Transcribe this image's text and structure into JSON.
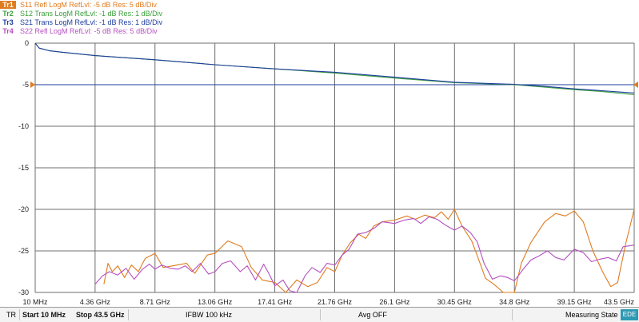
{
  "legend": [
    {
      "tag": "Tr1",
      "text": "S11 Refl LogM RefLvl: -5  dB Res: 5  dB/Div",
      "color": "#e07b1f",
      "active": true
    },
    {
      "tag": "Tr2",
      "text": "S12 Trans LogM RefLvl: -1  dB Res: 1  dB/Div",
      "color": "#3aa03a",
      "active": false
    },
    {
      "tag": "Tr3",
      "text": "S21 Trans LogM RefLvl: -1  dB Res: 1  dB/Div",
      "color": "#1f3f9e",
      "active": false
    },
    {
      "tag": "Tr4",
      "text": "S22 Refl LogM RefLvl: -5  dB Res: 5  dB/Div",
      "color": "#b44fc0",
      "active": false
    }
  ],
  "chart_data": {
    "type": "line",
    "x_tick_labels": [
      "10 MHz",
      "4.36 GHz",
      "8.71 GHz",
      "13.06 GHz",
      "17.41 GHz",
      "21.76 GHz",
      "26.1 GHz",
      "30.45 GHz",
      "34.8 GHz",
      "39.15 GHz",
      "43.5 GHz"
    ],
    "y_tick_labels": [
      "0",
      "-5",
      "-10",
      "-15",
      "-20",
      "-25",
      "-30"
    ],
    "xlim": [
      0.01,
      43.5
    ],
    "ylim": [
      -30,
      0
    ],
    "y_ticks": [
      0,
      -5,
      -10,
      -15,
      -20,
      -25,
      -30
    ],
    "grid": true,
    "ref_level": -5,
    "series": [
      {
        "name": "S12",
        "color": "#3aa03a",
        "x": [
          0.01,
          0.3,
          1.0,
          2.0,
          4.36,
          8.71,
          13.06,
          17.41,
          21.76,
          26.1,
          30.45,
          34.8,
          37.0,
          39.15,
          41.0,
          43.5
        ],
        "y": [
          0.0,
          -0.6,
          -0.9,
          -1.1,
          -1.5,
          -2.0,
          -2.6,
          -3.1,
          -3.6,
          -4.2,
          -4.75,
          -5.0,
          -5.3,
          -5.6,
          -5.8,
          -6.2
        ]
      },
      {
        "name": "S21",
        "color": "#1f3f9e",
        "x": [
          0.01,
          0.3,
          1.0,
          2.0,
          4.36,
          8.71,
          13.06,
          17.41,
          21.76,
          26.1,
          30.45,
          34.8,
          37.0,
          39.15,
          41.0,
          43.5
        ],
        "y": [
          0.0,
          -0.6,
          -0.9,
          -1.1,
          -1.5,
          -2.0,
          -2.6,
          -3.1,
          -3.5,
          -4.1,
          -4.7,
          -4.95,
          -5.2,
          -5.5,
          -5.7,
          -6.0
        ]
      },
      {
        "name": "S11",
        "color": "#e07b1f",
        "x": [
          5.0,
          5.3,
          5.6,
          6.0,
          6.5,
          7.0,
          7.5,
          8.0,
          8.71,
          9.3,
          10.0,
          11.0,
          11.6,
          12.5,
          13.06,
          14.0,
          15.0,
          15.7,
          16.5,
          17.41,
          18.2,
          19.0,
          19.8,
          20.5,
          21.2,
          21.76,
          22.3,
          22.9,
          23.5,
          24.0,
          24.6,
          25.2,
          26.1,
          27.0,
          27.6,
          28.3,
          29.0,
          29.5,
          30.0,
          30.45,
          31.0,
          31.7,
          32.2,
          32.7,
          33.3,
          34.0,
          34.8,
          35.3,
          36.0,
          37.0,
          37.8,
          38.5,
          39.15,
          39.8,
          40.5,
          41.2,
          41.8,
          42.3,
          42.9,
          43.5
        ],
        "y": [
          -29.0,
          -26.5,
          -27.5,
          -26.8,
          -28.2,
          -26.7,
          -27.5,
          -25.9,
          -25.3,
          -27.0,
          -26.8,
          -26.5,
          -27.7,
          -25.5,
          -25.3,
          -23.8,
          -24.5,
          -27.0,
          -28.5,
          -28.8,
          -30.0,
          -28.5,
          -29.3,
          -28.8,
          -27.0,
          -27.5,
          -25.5,
          -24.0,
          -23.0,
          -23.5,
          -22.0,
          -21.5,
          -21.3,
          -20.8,
          -21.2,
          -20.7,
          -21.0,
          -20.3,
          -21.2,
          -20.0,
          -22.0,
          -23.8,
          -26.0,
          -28.3,
          -29.0,
          -30.0,
          -30.0,
          -26.5,
          -24.0,
          -21.5,
          -20.5,
          -20.8,
          -20.2,
          -21.5,
          -25.0,
          -27.5,
          -29.3,
          -28.8,
          -24.0,
          -20.0
        ]
      },
      {
        "name": "S22",
        "color": "#b44fc0",
        "x": [
          4.36,
          4.9,
          5.4,
          6.0,
          6.6,
          7.2,
          7.8,
          8.3,
          8.71,
          9.2,
          9.8,
          10.4,
          10.9,
          11.4,
          12.0,
          12.6,
          13.06,
          13.6,
          14.2,
          14.9,
          15.4,
          16.0,
          16.6,
          17.0,
          17.41,
          18.0,
          18.5,
          19.0,
          19.6,
          20.1,
          20.7,
          21.2,
          21.76,
          22.3,
          22.8,
          23.4,
          24.0,
          24.6,
          25.2,
          26.1,
          26.8,
          27.5,
          28.0,
          28.6,
          29.2,
          29.8,
          30.45,
          31.0,
          31.6,
          32.1,
          32.6,
          33.2,
          33.8,
          34.3,
          34.8,
          35.4,
          36.0,
          36.6,
          37.2,
          37.8,
          38.4,
          39.15,
          39.8,
          40.4,
          41.0,
          41.6,
          42.2,
          42.7,
          43.5
        ],
        "y": [
          -29.0,
          -28.0,
          -27.5,
          -27.9,
          -27.1,
          -28.4,
          -27.2,
          -26.6,
          -27.2,
          -26.7,
          -27.1,
          -27.2,
          -26.8,
          -27.5,
          -26.5,
          -27.8,
          -27.5,
          -26.5,
          -26.2,
          -27.5,
          -26.8,
          -28.5,
          -26.6,
          -27.8,
          -29.2,
          -28.5,
          -29.8,
          -30.0,
          -28.0,
          -27.0,
          -27.6,
          -26.5,
          -26.7,
          -25.5,
          -24.8,
          -23.0,
          -22.8,
          -22.3,
          -21.5,
          -21.7,
          -21.3,
          -21.1,
          -21.7,
          -20.9,
          -21.2,
          -21.9,
          -22.5,
          -22.0,
          -22.8,
          -23.9,
          -26.5,
          -28.4,
          -28.0,
          -28.2,
          -28.6,
          -27.3,
          -26.1,
          -25.6,
          -25.0,
          -25.8,
          -26.1,
          -24.8,
          -25.2,
          -26.3,
          -26.0,
          -25.8,
          -26.2,
          -24.5,
          -24.3
        ]
      }
    ]
  },
  "statusbar": {
    "tr": "TR",
    "start": "Start 10 MHz",
    "stop": "Stop 43.5 GHz",
    "ifbw": "IFBW 100 kHz",
    "avg": "Avg OFF",
    "state": "Measuring State",
    "edge": "EDE"
  },
  "colors": {
    "grid": "#6f6f6f",
    "marker": "#e07b1f",
    "ref_line": "#1f3f9e"
  }
}
